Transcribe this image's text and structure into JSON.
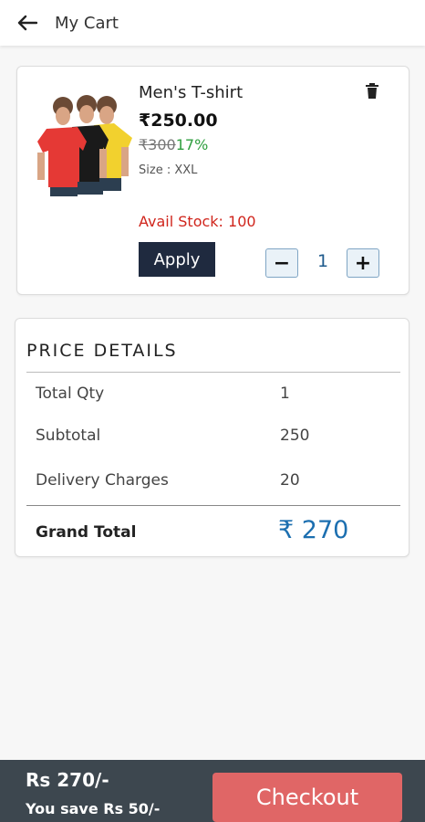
{
  "header": {
    "title": "My Cart",
    "back_icon": "arrow-left-icon"
  },
  "cart_item": {
    "name": "Men's T-shirt",
    "price": "₹250.00",
    "mrp": "₹300",
    "discount": "17%",
    "size": "Size : XXL",
    "stock": "Avail Stock: 100",
    "apply_label": "Apply",
    "quantity": "1",
    "minus_label": "−",
    "plus_label": "+",
    "delete_icon": "trash-icon",
    "shirt_colors": [
      "#e53935",
      "#1a1a1a",
      "#f2d12e"
    ]
  },
  "price_details": {
    "title": "PRICE DETAILS",
    "rows": [
      {
        "label": "Total Qty",
        "value": "1"
      },
      {
        "label": "Subtotal",
        "value": "250"
      },
      {
        "label": "Delivery Charges",
        "value": "20"
      }
    ],
    "grand_total_label": "Grand Total",
    "grand_total_value": "₹ 270"
  },
  "footer": {
    "total": "Rs 270/-",
    "savings": "You save Rs 50/-",
    "checkout_label": "Checkout"
  },
  "colors": {
    "accent_blue": "#1c6fb0",
    "stock_red": "#d0251c",
    "discount_green": "#2e9e3e",
    "apply_bg": "#1f2a3f",
    "footer_bg": "#3d474f",
    "checkout_bg": "#e06666"
  }
}
